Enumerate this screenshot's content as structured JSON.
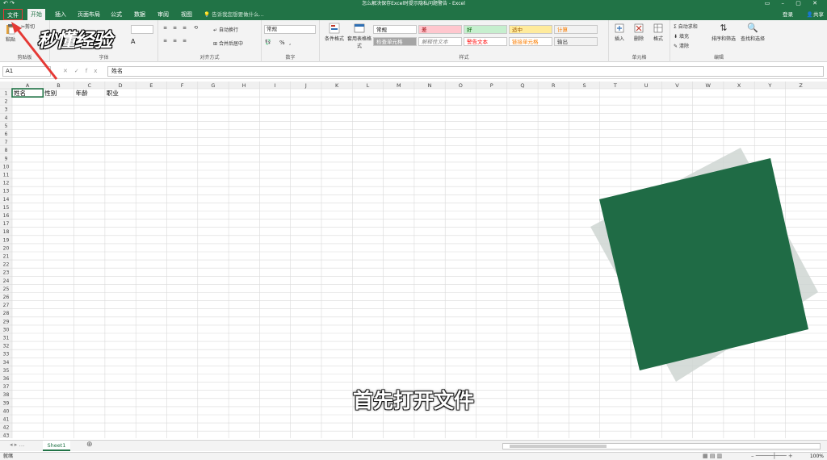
{
  "titlebar": {
    "doc_title": "怎么解决保存Excel时提示隐私问题警告 - Excel",
    "quick_access": "↶ ↷",
    "window_controls": "▭ – ▢ ✕"
  },
  "tabs": {
    "file": "文件",
    "home": "开始",
    "insert": "插入",
    "page_layout": "页面布局",
    "formulas": "公式",
    "data": "数据",
    "review": "审阅",
    "view": "视图",
    "tell_me": "告诉我您想要做什么...",
    "sign_in": "登录",
    "share": "共享"
  },
  "ribbon": {
    "clipboard": {
      "label": "剪贴板",
      "paste": "粘贴",
      "cut": "剪切"
    },
    "font": {
      "label": "字体"
    },
    "alignment": {
      "label": "对齐方式",
      "wrap": "自动换行",
      "merge": "合并后居中"
    },
    "number": {
      "label": "数字",
      "format": "常规",
      "percent": "%",
      "comma": ","
    },
    "styles": {
      "label": "样式",
      "conditional": "条件格式",
      "table": "套用表格格式",
      "cells": [
        {
          "text": "常规",
          "bg": "#ffffff",
          "fg": "#000000"
        },
        {
          "text": "差",
          "bg": "#ffc7ce",
          "fg": "#9c0006"
        },
        {
          "text": "好",
          "bg": "#c6efce",
          "fg": "#006100"
        },
        {
          "text": "适中",
          "bg": "#ffeb9c",
          "fg": "#9c5700"
        },
        {
          "text": "计算",
          "bg": "#f2f2f2",
          "fg": "#fa7d00"
        },
        {
          "text": "检查单元格",
          "bg": "#a5a5a5",
          "fg": "#ffffff"
        },
        {
          "text": "解释性文本",
          "bg": "#ffffff",
          "fg": "#7f7f7f"
        },
        {
          "text": "警告文本",
          "bg": "#ffffff",
          "fg": "#ff0000"
        },
        {
          "text": "链接单元格",
          "bg": "#ffffff",
          "fg": "#fa7d00"
        },
        {
          "text": "输出",
          "bg": "#f2f2f2",
          "fg": "#3f3f3f"
        }
      ]
    },
    "cells": {
      "label": "单元格",
      "insert": "插入",
      "delete": "删除",
      "format": "格式"
    },
    "editing": {
      "label": "编辑",
      "autosum": "自动求和",
      "fill": "填充",
      "clear": "清除",
      "sort": "排序和筛选",
      "find": "查找和选择"
    }
  },
  "watermark": "秒懂经验",
  "formula_bar": {
    "name_box": "A1",
    "fx": "fx",
    "content": "姓名"
  },
  "grid": {
    "columns": [
      "A",
      "B",
      "C",
      "D",
      "E",
      "F",
      "G",
      "H",
      "I",
      "J",
      "K",
      "L",
      "M",
      "N",
      "O",
      "P",
      "Q",
      "R",
      "S",
      "T",
      "U",
      "V",
      "W",
      "X",
      "Y",
      "Z"
    ],
    "row_count": 43,
    "cells": [
      {
        "col": 0,
        "row": 0,
        "text": "姓名"
      },
      {
        "col": 1,
        "row": 0,
        "text": "性别"
      },
      {
        "col": 2,
        "row": 0,
        "text": "年龄"
      },
      {
        "col": 3,
        "row": 0,
        "text": "职业"
      }
    ],
    "selected": {
      "col": 0,
      "row": 0
    }
  },
  "sheet_tab": "Sheet1",
  "status": {
    "ready": "就绪",
    "zoom": "100%"
  },
  "subtitle": "首先打开文件",
  "colors": {
    "excel_green": "#217346",
    "arrow_red": "#e53935"
  }
}
